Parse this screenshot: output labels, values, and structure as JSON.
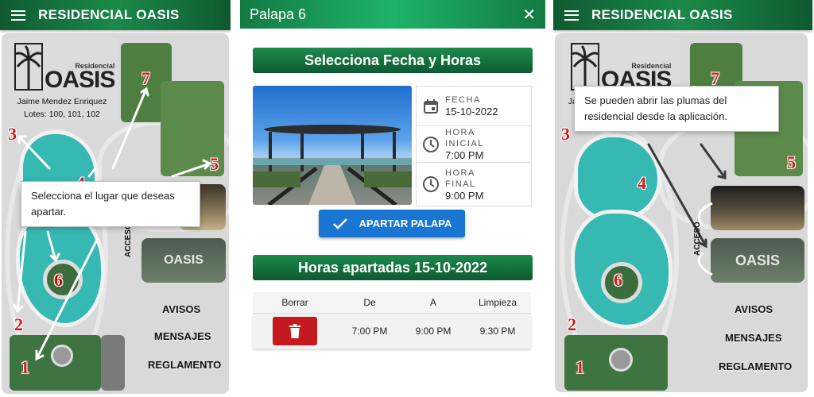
{
  "left_panel": {
    "appbar_title": "RESIDENCIAL OASIS",
    "logo_small": "Residencial",
    "logo_big": "OASIS",
    "user_name": "Jaime Mendez Enriquez",
    "user_lots": "Lotes: 100, 101, 102",
    "tooltip": "Selecciona el lugar que deseas apartar.",
    "acceso": "ACCESO",
    "menu": [
      "AVISOS",
      "MENSAJES",
      "REGLAMENTO"
    ],
    "numbers": [
      "7",
      "3",
      "5",
      "4",
      "6",
      "2",
      "1"
    ]
  },
  "middle_panel": {
    "dialog_title": "Palapa 6",
    "close_icon": "close-icon",
    "heading_select": "Selecciona Fecha y Horas",
    "fecha_label": "FECHA",
    "fecha_value": "15-10-2022",
    "hora_inicial_label_1": "HORA",
    "hora_inicial_label_2": "INICIAL",
    "hora_inicial_value": "7:00 PM",
    "hora_final_label_1": "HORA",
    "hora_final_label_2": "FINAL",
    "hora_final_value": "9:00 PM",
    "apartar_button": "APARTAR PALAPA",
    "heading_reserved": "Horas apartadas 15-10-2022",
    "table_headers": [
      "Borrar",
      "De",
      "A",
      "Limpieza"
    ],
    "table_rows": [
      {
        "de": "7:00 PM",
        "a": "9:00 PM",
        "limpieza": "9:30 PM"
      }
    ]
  },
  "right_panel": {
    "appbar_title": "RESIDENCIAL OASIS",
    "logo_small": "Residencial",
    "logo_big": "OASIS",
    "user_name_partial": "Jaim",
    "user_lots_partial": "L",
    "tooltip": "Se pueden abrir las plumas del residencial desde la aplicación.",
    "acceso": "ACCESO",
    "menu": [
      "AVISOS",
      "MENSAJES",
      "REGLAMENTO"
    ],
    "numbers": [
      "7",
      "3",
      "5",
      "4",
      "6",
      "2",
      "1"
    ]
  },
  "colors": {
    "appbar_green": "#1a8a4a",
    "pool": "#36b8b3",
    "button_blue": "#1976d2",
    "delete_red": "#c41a1f",
    "number_red": "#d11a1a"
  }
}
